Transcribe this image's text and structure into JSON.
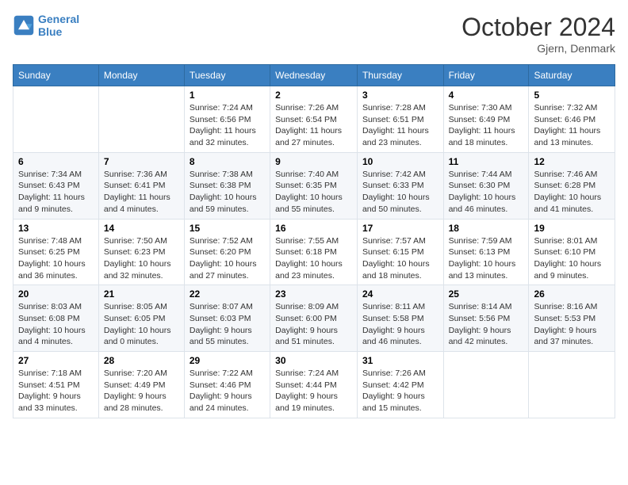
{
  "header": {
    "logo_line1": "General",
    "logo_line2": "Blue",
    "month": "October 2024",
    "location": "Gjern, Denmark"
  },
  "days_of_week": [
    "Sunday",
    "Monday",
    "Tuesday",
    "Wednesday",
    "Thursday",
    "Friday",
    "Saturday"
  ],
  "weeks": [
    [
      {
        "day": "",
        "detail": ""
      },
      {
        "day": "",
        "detail": ""
      },
      {
        "day": "1",
        "detail": "Sunrise: 7:24 AM\nSunset: 6:56 PM\nDaylight: 11 hours and 32 minutes."
      },
      {
        "day": "2",
        "detail": "Sunrise: 7:26 AM\nSunset: 6:54 PM\nDaylight: 11 hours and 27 minutes."
      },
      {
        "day": "3",
        "detail": "Sunrise: 7:28 AM\nSunset: 6:51 PM\nDaylight: 11 hours and 23 minutes."
      },
      {
        "day": "4",
        "detail": "Sunrise: 7:30 AM\nSunset: 6:49 PM\nDaylight: 11 hours and 18 minutes."
      },
      {
        "day": "5",
        "detail": "Sunrise: 7:32 AM\nSunset: 6:46 PM\nDaylight: 11 hours and 13 minutes."
      }
    ],
    [
      {
        "day": "6",
        "detail": "Sunrise: 7:34 AM\nSunset: 6:43 PM\nDaylight: 11 hours and 9 minutes."
      },
      {
        "day": "7",
        "detail": "Sunrise: 7:36 AM\nSunset: 6:41 PM\nDaylight: 11 hours and 4 minutes."
      },
      {
        "day": "8",
        "detail": "Sunrise: 7:38 AM\nSunset: 6:38 PM\nDaylight: 10 hours and 59 minutes."
      },
      {
        "day": "9",
        "detail": "Sunrise: 7:40 AM\nSunset: 6:35 PM\nDaylight: 10 hours and 55 minutes."
      },
      {
        "day": "10",
        "detail": "Sunrise: 7:42 AM\nSunset: 6:33 PM\nDaylight: 10 hours and 50 minutes."
      },
      {
        "day": "11",
        "detail": "Sunrise: 7:44 AM\nSunset: 6:30 PM\nDaylight: 10 hours and 46 minutes."
      },
      {
        "day": "12",
        "detail": "Sunrise: 7:46 AM\nSunset: 6:28 PM\nDaylight: 10 hours and 41 minutes."
      }
    ],
    [
      {
        "day": "13",
        "detail": "Sunrise: 7:48 AM\nSunset: 6:25 PM\nDaylight: 10 hours and 36 minutes."
      },
      {
        "day": "14",
        "detail": "Sunrise: 7:50 AM\nSunset: 6:23 PM\nDaylight: 10 hours and 32 minutes."
      },
      {
        "day": "15",
        "detail": "Sunrise: 7:52 AM\nSunset: 6:20 PM\nDaylight: 10 hours and 27 minutes."
      },
      {
        "day": "16",
        "detail": "Sunrise: 7:55 AM\nSunset: 6:18 PM\nDaylight: 10 hours and 23 minutes."
      },
      {
        "day": "17",
        "detail": "Sunrise: 7:57 AM\nSunset: 6:15 PM\nDaylight: 10 hours and 18 minutes."
      },
      {
        "day": "18",
        "detail": "Sunrise: 7:59 AM\nSunset: 6:13 PM\nDaylight: 10 hours and 13 minutes."
      },
      {
        "day": "19",
        "detail": "Sunrise: 8:01 AM\nSunset: 6:10 PM\nDaylight: 10 hours and 9 minutes."
      }
    ],
    [
      {
        "day": "20",
        "detail": "Sunrise: 8:03 AM\nSunset: 6:08 PM\nDaylight: 10 hours and 4 minutes."
      },
      {
        "day": "21",
        "detail": "Sunrise: 8:05 AM\nSunset: 6:05 PM\nDaylight: 10 hours and 0 minutes."
      },
      {
        "day": "22",
        "detail": "Sunrise: 8:07 AM\nSunset: 6:03 PM\nDaylight: 9 hours and 55 minutes."
      },
      {
        "day": "23",
        "detail": "Sunrise: 8:09 AM\nSunset: 6:00 PM\nDaylight: 9 hours and 51 minutes."
      },
      {
        "day": "24",
        "detail": "Sunrise: 8:11 AM\nSunset: 5:58 PM\nDaylight: 9 hours and 46 minutes."
      },
      {
        "day": "25",
        "detail": "Sunrise: 8:14 AM\nSunset: 5:56 PM\nDaylight: 9 hours and 42 minutes."
      },
      {
        "day": "26",
        "detail": "Sunrise: 8:16 AM\nSunset: 5:53 PM\nDaylight: 9 hours and 37 minutes."
      }
    ],
    [
      {
        "day": "27",
        "detail": "Sunrise: 7:18 AM\nSunset: 4:51 PM\nDaylight: 9 hours and 33 minutes."
      },
      {
        "day": "28",
        "detail": "Sunrise: 7:20 AM\nSunset: 4:49 PM\nDaylight: 9 hours and 28 minutes."
      },
      {
        "day": "29",
        "detail": "Sunrise: 7:22 AM\nSunset: 4:46 PM\nDaylight: 9 hours and 24 minutes."
      },
      {
        "day": "30",
        "detail": "Sunrise: 7:24 AM\nSunset: 4:44 PM\nDaylight: 9 hours and 19 minutes."
      },
      {
        "day": "31",
        "detail": "Sunrise: 7:26 AM\nSunset: 4:42 PM\nDaylight: 9 hours and 15 minutes."
      },
      {
        "day": "",
        "detail": ""
      },
      {
        "day": "",
        "detail": ""
      }
    ]
  ]
}
